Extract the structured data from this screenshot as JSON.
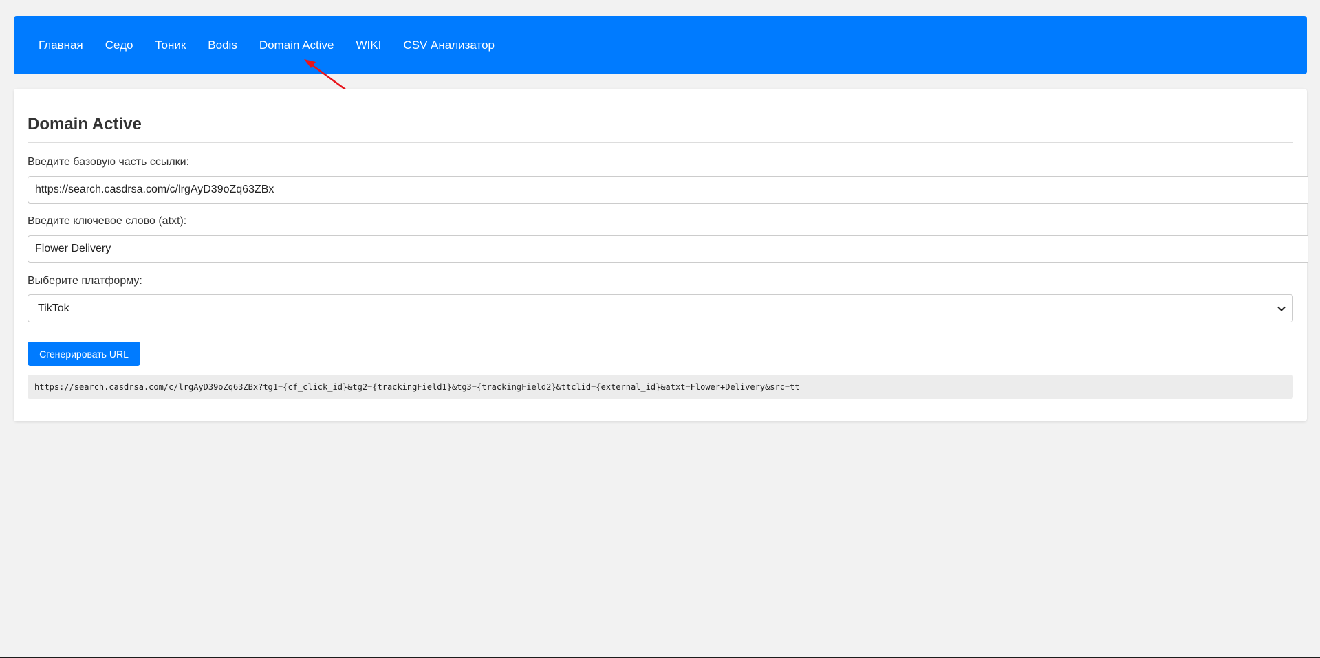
{
  "nav": {
    "items": [
      {
        "label": "Главная"
      },
      {
        "label": "Седо"
      },
      {
        "label": "Тоник"
      },
      {
        "label": "Bodis"
      },
      {
        "label": "Domain Active"
      },
      {
        "label": "WIKI"
      },
      {
        "label": "CSV Анализатор"
      }
    ]
  },
  "annotation": {
    "arrow_color": "#e8141b",
    "arrow_target": "Domain Active"
  },
  "form": {
    "title": "Domain Active",
    "base_link_label": "Введите базовую часть ссылки:",
    "base_link_value": "https://search.casdrsa.com/c/lrgAyD39oZq63ZBx",
    "keyword_label": "Введите ключевое слово (atxt):",
    "keyword_value": "Flower Delivery",
    "platform_label": "Выберите платформу:",
    "platform_value": "TikTok",
    "generate_label": "Сгенерировать URL",
    "result_url": "https://search.casdrsa.com/c/lrgAyD39oZq63ZBx?tg1={cf_click_id}&tg2={trackingField1}&tg3={trackingField2}&ttclid={external_id}&atxt=Flower+Delivery&src=tt"
  },
  "colors": {
    "accent": "#007bff",
    "page_background": "#f2f2f2",
    "card_background": "#ffffff",
    "result_background": "#ececec"
  },
  "icons": {
    "select_chevron": "chevron-down-icon"
  }
}
